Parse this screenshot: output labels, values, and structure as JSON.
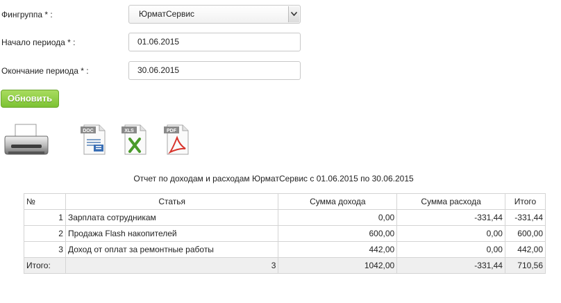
{
  "form": {
    "fingroup_label": "Фингруппа * :",
    "fingroup_value": "ЮрматСервис",
    "start_label": "Начало периода * :",
    "start_value": "01.06.2015",
    "end_label": "Окончание периода * :",
    "end_value": "30.06.2015",
    "refresh_label": "Обновить"
  },
  "icons": {
    "print": "printer-icon",
    "doc_label": "DOC",
    "xls_label": "XLS",
    "pdf_label": "PDF"
  },
  "report": {
    "title": "Отчет по доходам и расходам ЮрматСервис с 01.06.2015 по 30.06.2015",
    "headers": [
      "№",
      "Статья",
      "Сумма дохода",
      "Сумма расхода",
      "Итого"
    ],
    "rows": [
      {
        "no": "1",
        "item": "Зарплата сотрудникам",
        "income": "0,00",
        "expense": "-331,44",
        "total": "-331,44"
      },
      {
        "no": "2",
        "item": "Продажа Flash накопителей",
        "income": "600,00",
        "expense": "0,00",
        "total": "600,00"
      },
      {
        "no": "3",
        "item": "Доход от оплат за ремонтные работы",
        "income": "442,00",
        "expense": "0,00",
        "total": "442,00"
      }
    ],
    "totals": {
      "label": "Итого:",
      "count": "3",
      "income": "1042,00",
      "expense": "-331,44",
      "total": "710,56"
    }
  },
  "colors": {
    "button_green": "#7cc233",
    "doc_blue": "#3a6fb5",
    "xls_green": "#4a9a2a",
    "pdf_red": "#d8342c"
  }
}
